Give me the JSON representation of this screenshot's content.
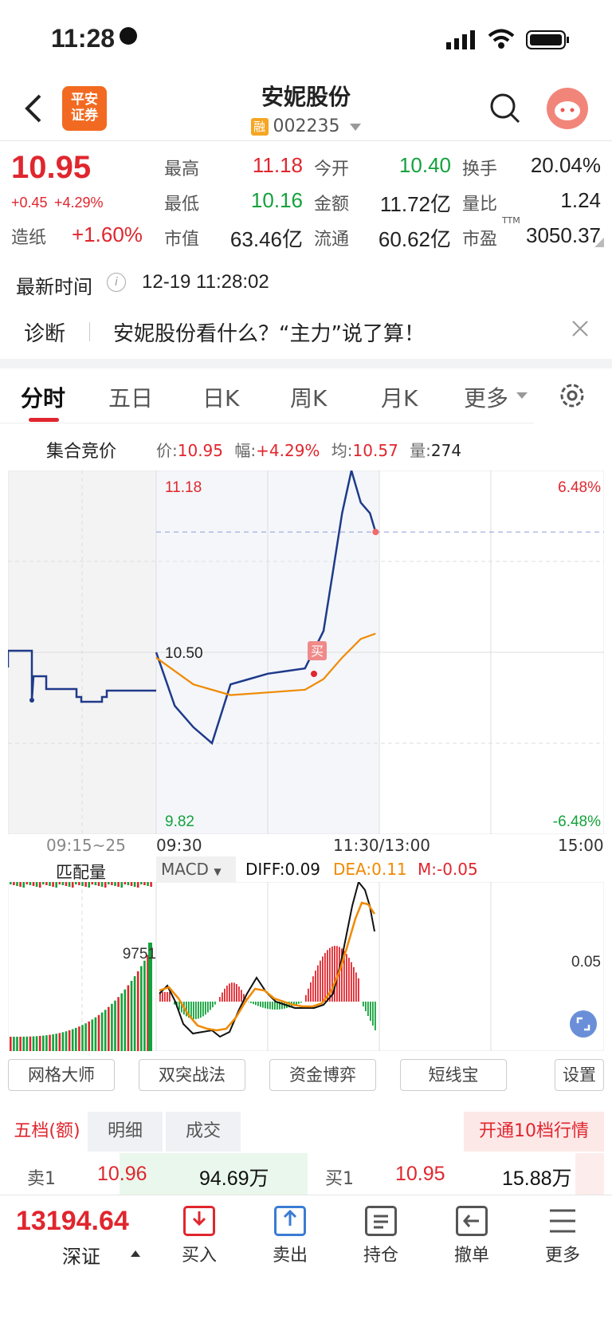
{
  "status_bar": {
    "time": "11:28"
  },
  "header": {
    "title": "安妮股份",
    "rong": "融",
    "code": "002235",
    "logo_line1": "平安",
    "logo_line2": "证券"
  },
  "quote": {
    "price": "10.95",
    "change": "+0.45",
    "change_pct": "+4.29%",
    "sector_name": "造纸",
    "sector_pct": "+1.60%",
    "fields": [
      {
        "label": "最高",
        "value": "11.18"
      },
      {
        "label": "今开",
        "value": "10.40"
      },
      {
        "label": "换手",
        "value": "20.04%"
      },
      {
        "label": "最低",
        "value": "10.16"
      },
      {
        "label": "金额",
        "value": "11.72亿"
      },
      {
        "label": "量比",
        "value": "1.24"
      },
      {
        "label": "市值",
        "value": "63.46亿"
      },
      {
        "label": "流通",
        "value": "60.62亿"
      },
      {
        "label": "市盈",
        "value": "3050.37",
        "sup": "TTM"
      }
    ]
  },
  "update": {
    "label": "最新时间",
    "value": "12-19 11:28:02"
  },
  "diagnosis": {
    "label": "诊断",
    "text": "安妮股份看什么？“主力”说了算！"
  },
  "tabs": [
    "分时",
    "五日",
    "日K",
    "周K",
    "月K",
    "更多"
  ],
  "auction": {
    "title": "集合竞价",
    "price_label": "价:",
    "price": "10.95",
    "range_label": "幅:",
    "range": "+4.29%",
    "avg_label": "均:",
    "avg": "10.57",
    "vol_label": "量:",
    "vol": "274"
  },
  "chart_labels": {
    "high": "11.18",
    "mid": "10.50",
    "low": "9.82",
    "pct_high": "6.48%",
    "pct_low": "-6.48%",
    "t_auction": "09:15~25",
    "t_open": "09:30",
    "t_mid": "11:30/13:00",
    "t_close": "15:00",
    "buy_marker": "买",
    "match_vol": "匹配量",
    "auction_vol": "9751",
    "macd_select": "MACD",
    "diff": "DIFF:0.09",
    "dea": "DEA:0.11",
    "m": "M:-0.05",
    "macd_tick": "0.05"
  },
  "chart_data": [
    {
      "type": "line",
      "title": "分时",
      "x_range": [
        "09:30",
        "15:00"
      ],
      "ylim": [
        9.82,
        11.18
      ],
      "series": [
        {
          "name": "价",
          "color": "#1f3a8a",
          "x": [
            "09:30",
            "09:40",
            "09:50",
            "10:00",
            "10:10",
            "10:20",
            "10:30",
            "10:40",
            "10:50",
            "11:00",
            "11:05",
            "11:10",
            "11:15",
            "11:20",
            "11:25",
            "11:28"
          ],
          "values": [
            10.5,
            10.3,
            10.22,
            10.16,
            10.38,
            10.4,
            10.42,
            10.43,
            10.44,
            10.58,
            10.8,
            11.02,
            11.18,
            11.06,
            11.02,
            10.95
          ]
        },
        {
          "name": "均",
          "color": "#f08a00",
          "x": [
            "09:30",
            "09:50",
            "10:10",
            "10:30",
            "10:50",
            "11:00",
            "11:10",
            "11:20",
            "11:28"
          ],
          "values": [
            10.48,
            10.38,
            10.34,
            10.35,
            10.36,
            10.4,
            10.48,
            10.55,
            10.57
          ]
        }
      ]
    },
    {
      "type": "bar",
      "title": "MACD",
      "series": [
        {
          "name": "DIFF",
          "value": 0.09
        },
        {
          "name": "DEA",
          "value": 0.11
        },
        {
          "name": "M",
          "value": -0.05
        }
      ]
    }
  ],
  "function_buttons": [
    "网格大师",
    "双突战法",
    "资金博弈",
    "短线宝",
    "设置"
  ],
  "order_tabs": [
    "五档(额)",
    "明细",
    "成交"
  ],
  "open_level10": "开通10档行情",
  "order_book": {
    "sell_label": "卖1",
    "sell_price": "10.96",
    "sell_amount": "94.69万",
    "buy_label": "买1",
    "buy_price": "10.95",
    "buy_amount": "15.88万"
  },
  "bottom": {
    "index_value": "13194.64",
    "index_name": "深证",
    "items": [
      "买入",
      "卖出",
      "持仓",
      "撤单",
      "更多"
    ]
  },
  "colors": {
    "up": "#e0262e",
    "down": "#14a23c",
    "price_line": "#1f3a8a",
    "avg_line": "#f08a00"
  }
}
